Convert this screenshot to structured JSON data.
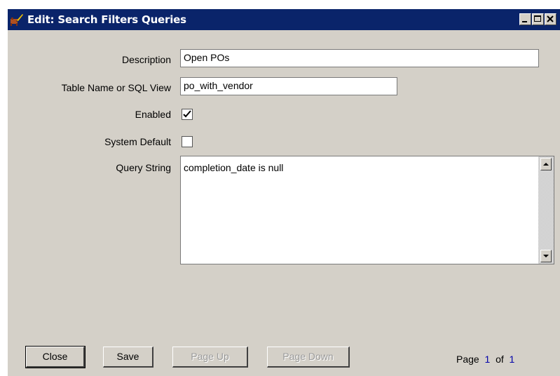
{
  "window": {
    "title": "Edit: Search Filters Queries",
    "icon": "app-icon",
    "controls": [
      "minimize-icon",
      "maximize-icon",
      "close-icon"
    ]
  },
  "form": {
    "description_label": "Description",
    "description_value": "Open POs",
    "table_label": "Table Name or SQL View",
    "table_value": "po_with_vendor",
    "enabled_label": "Enabled",
    "enabled_checked": true,
    "system_default_label": "System Default",
    "system_default_checked": false,
    "query_label": "Query String",
    "query_value": "completion_date is null"
  },
  "buttons": {
    "close": "Close",
    "save": "Save",
    "page_up": "Page Up",
    "page_down": "Page Down"
  },
  "pager": {
    "page_word": "Page",
    "current": "1",
    "of_word": "of",
    "total": "1"
  },
  "colors": {
    "titlebar": "#0a246a",
    "face": "#d4d0c8",
    "page_number": "#0000aa"
  }
}
